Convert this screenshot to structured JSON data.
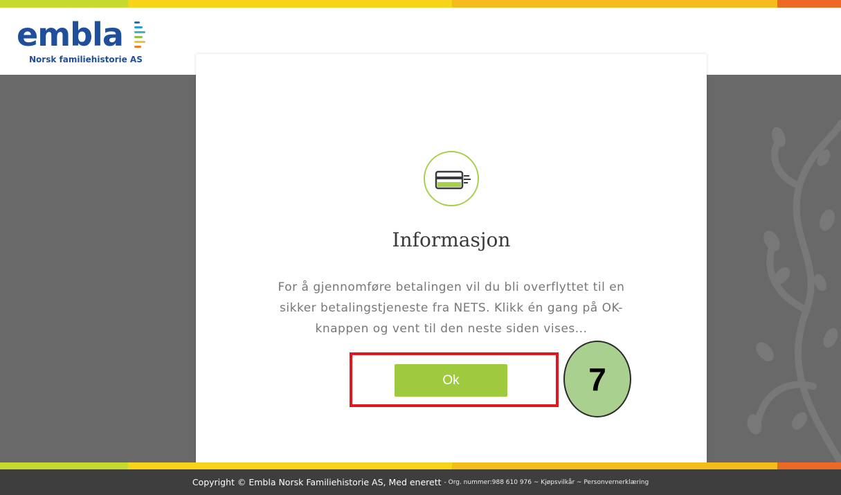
{
  "header": {
    "logo_word": "embla",
    "logo_subtitle": "Norsk familiehistorie AS"
  },
  "dialog": {
    "icon": "credit-card-icon",
    "title": "Informasjon",
    "message": "For å gjennomføre betalingen vil du bli overflyttet til en sikker betalingstjeneste fra NETS. Klikk én gang på OK-knappen og vent til den neste siden vises...",
    "ok_label": "Ok"
  },
  "annotation": {
    "step_number": "7"
  },
  "footer": {
    "copyright": "Copyright © Embla Norsk Familiehistorie AS, Med enerett",
    "details": "- Org. nummer:988 610 976 ~ Kjøpsvilkår ~ Personvernerklæring"
  },
  "colors": {
    "brand_blue": "#1f4e9b",
    "accent_green": "#9fca3d",
    "highlight_red": "#e3161e",
    "badge_green": "#a9d08e"
  }
}
